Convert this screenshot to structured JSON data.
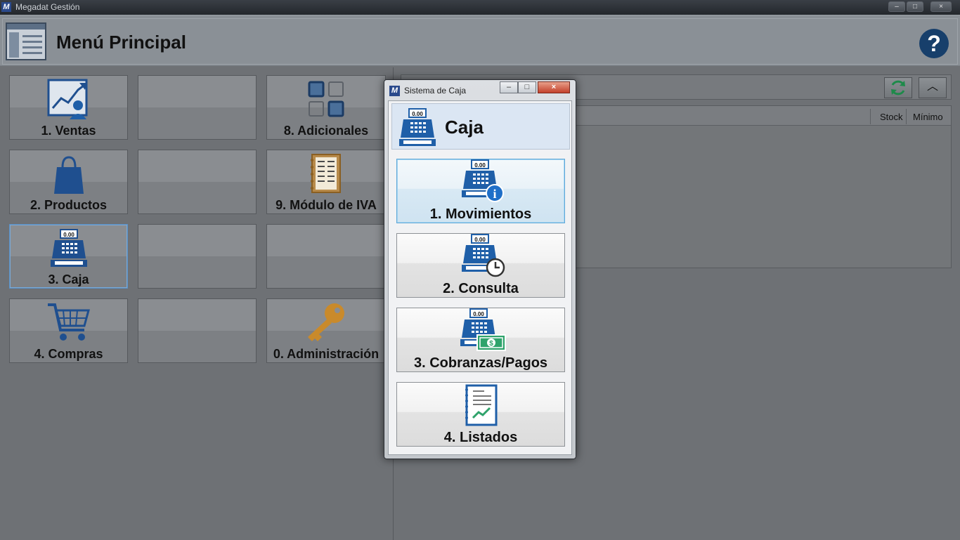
{
  "window": {
    "title": "Megadat Gestión",
    "app_icon": "M"
  },
  "header": {
    "title": "Menú Principal",
    "help_symbol": "?"
  },
  "tiles": [
    {
      "label": "1. Ventas",
      "icon": "sales-chart-icon"
    },
    {
      "label": "",
      "icon": ""
    },
    {
      "label": "8. Adicionales",
      "icon": "grid-squares-icon"
    },
    {
      "label": "2. Productos",
      "icon": "shopping-bag-icon"
    },
    {
      "label": "",
      "icon": ""
    },
    {
      "label": "9. Módulo de IVA",
      "icon": "ledger-book-icon"
    },
    {
      "label": "3. Caja",
      "icon": "cash-register-icon"
    },
    {
      "label": "",
      "icon": ""
    },
    {
      "label": "",
      "icon": ""
    },
    {
      "label": "4. Compras",
      "icon": "shopping-cart-icon"
    },
    {
      "label": "",
      "icon": ""
    },
    {
      "label": "0. Administración",
      "icon": "key-icon"
    }
  ],
  "table": {
    "columns": [
      "Stock",
      "Mínimo"
    ]
  },
  "dialog": {
    "title": "Sistema de Caja",
    "header_title": "Caja",
    "register_display": "0.00",
    "buttons": [
      {
        "label": "1. Movimientos",
        "icon": "register-info-icon"
      },
      {
        "label": "2. Consulta",
        "icon": "register-clock-icon"
      },
      {
        "label": "3. Cobranzas/Pagos",
        "icon": "register-money-icon"
      },
      {
        "label": "4. Listados",
        "icon": "report-list-icon"
      }
    ]
  },
  "colors": {
    "accent_blue": "#1f5fa8",
    "gold": "#c98a2b",
    "green": "#2fa36b"
  }
}
